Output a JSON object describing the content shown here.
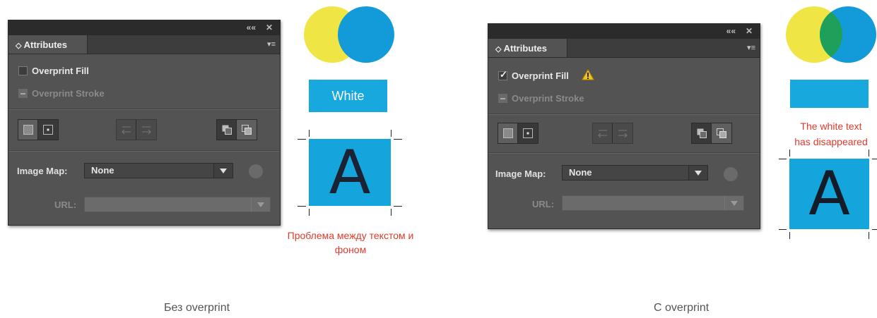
{
  "panels": [
    {
      "titlebar": {
        "collapse_glyph": "««",
        "close_glyph": "✕"
      },
      "tab_label": "Attributes",
      "tab_chevron_glyph": "◇",
      "menu_glyph": "▾≡",
      "overprint_fill": {
        "label": "Overprint Fill",
        "checked": false
      },
      "overprint_stroke": {
        "label": "Overprint Stroke"
      },
      "image_map": {
        "label": "Image Map:",
        "value": "None"
      },
      "url": {
        "label": "URL:",
        "value": ""
      },
      "warning": false
    },
    {
      "titlebar": {
        "collapse_glyph": "««",
        "close_glyph": "✕"
      },
      "tab_label": "Attributes",
      "tab_chevron_glyph": "◇",
      "menu_glyph": "▾≡",
      "overprint_fill": {
        "label": "Overprint Fill",
        "checked": true,
        "check_glyph": "✓"
      },
      "overprint_stroke": {
        "label": "Overprint Stroke"
      },
      "image_map": {
        "label": "Image Map:",
        "value": "None"
      },
      "url": {
        "label": "URL:",
        "value": ""
      },
      "warning": true
    }
  ],
  "left_demo": {
    "swatch_text": "White",
    "letter": "A",
    "note": "Проблема между текстом и фоном"
  },
  "right_demo": {
    "letter": "A",
    "note_line1": "The white text",
    "note_line2": "has disappeared"
  },
  "captions": {
    "left": "Без overprint",
    "right": "С overprint"
  },
  "colors": {
    "panel_bg": "#535353",
    "titlebar": "#2b2b2b",
    "yellow": "#efe646",
    "blue": "#139ad8",
    "overlap_green": "#1fa05a",
    "cyan_box": "#17a8dd",
    "note_red": "#e03a2a",
    "warning": "#f3c21b"
  }
}
